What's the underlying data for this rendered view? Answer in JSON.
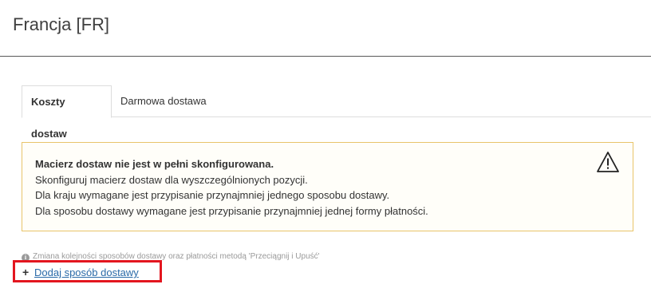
{
  "header": {
    "title": "Francja [FR]"
  },
  "tabs": [
    {
      "label": "Koszty dostaw",
      "active": true
    },
    {
      "label": "Darmowa dostawa",
      "active": false
    }
  ],
  "alert": {
    "title": "Macierz dostaw nie jest w pełni skonfigurowana.",
    "lines": [
      "Skonfiguruj macierz dostaw dla wyszczególnionych pozycji.",
      "Dla kraju wymagane jest przypisanie przynajmniej jednego sposobu dostawy.",
      "Dla sposobu dostawy wymagane jest przypisanie przynajmniej jednej formy płatności."
    ],
    "icon": "warning-triangle-icon",
    "border_color": "#e8c46a"
  },
  "info": {
    "icon": "info-icon",
    "text": "Zmiana kolejności sposobów dostawy oraz płatności metodą 'Przeciągnij i Upuść'"
  },
  "add_shipping": {
    "icon": "plus-icon",
    "label": "Dodaj sposób dostawy",
    "highlight_color": "#e3161f",
    "link_color": "#2a6aa8"
  }
}
